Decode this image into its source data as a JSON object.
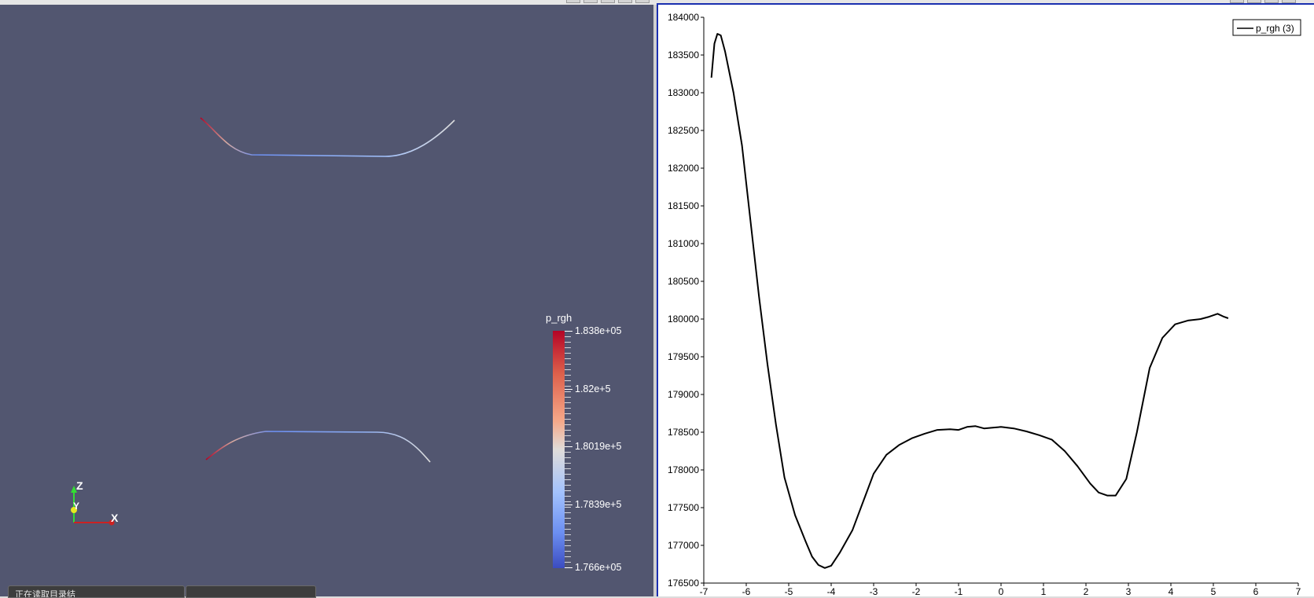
{
  "render_view": {
    "color_legend": {
      "title": "p_rgh",
      "labels": [
        "1.838e+05",
        "1.82e+5",
        "1.8019e+5",
        "1.7839e+5",
        "1.766e+05"
      ]
    },
    "orientation_axes": {
      "z": "Z",
      "y": "Y",
      "x": "X"
    }
  },
  "status_bar": {
    "tab_1": "正在读取目录结",
    "tab_2": ""
  },
  "chart_data": {
    "type": "line",
    "title": "",
    "xlabel": "",
    "ylabel": "",
    "xlim": [
      -7,
      7
    ],
    "ylim": [
      176500,
      184000
    ],
    "x_ticks": [
      "-7",
      "-6",
      "-5",
      "-4",
      "-3",
      "-2",
      "-1",
      "0",
      "1",
      "2",
      "3",
      "4",
      "5",
      "6",
      "7"
    ],
    "y_ticks": [
      "184000",
      "183500",
      "183000",
      "182500",
      "182000",
      "181500",
      "181000",
      "180500",
      "180000",
      "179500",
      "179000",
      "178500",
      "178000",
      "177500",
      "177000",
      "176500"
    ],
    "legend_position": "top-right",
    "series": [
      {
        "name": "p_rgh (3)",
        "color": "#000000",
        "points": [
          [
            -6.82,
            183200
          ],
          [
            -6.75,
            183650
          ],
          [
            -6.68,
            183780
          ],
          [
            -6.6,
            183760
          ],
          [
            -6.5,
            183550
          ],
          [
            -6.3,
            183000
          ],
          [
            -6.1,
            182300
          ],
          [
            -5.9,
            181300
          ],
          [
            -5.7,
            180300
          ],
          [
            -5.5,
            179400
          ],
          [
            -5.3,
            178600
          ],
          [
            -5.1,
            177900
          ],
          [
            -4.85,
            177400
          ],
          [
            -4.6,
            177050
          ],
          [
            -4.45,
            176850
          ],
          [
            -4.3,
            176740
          ],
          [
            -4.15,
            176700
          ],
          [
            -4.0,
            176730
          ],
          [
            -3.8,
            176900
          ],
          [
            -3.5,
            177200
          ],
          [
            -3.2,
            177650
          ],
          [
            -3.0,
            177950
          ],
          [
            -2.7,
            178200
          ],
          [
            -2.4,
            178330
          ],
          [
            -2.1,
            178420
          ],
          [
            -1.8,
            178480
          ],
          [
            -1.5,
            178530
          ],
          [
            -1.2,
            178540
          ],
          [
            -1.0,
            178530
          ],
          [
            -0.8,
            178570
          ],
          [
            -0.6,
            178580
          ],
          [
            -0.4,
            178550
          ],
          [
            -0.2,
            178560
          ],
          [
            0.0,
            178570
          ],
          [
            0.3,
            178550
          ],
          [
            0.6,
            178510
          ],
          [
            0.9,
            178460
          ],
          [
            1.2,
            178400
          ],
          [
            1.5,
            178250
          ],
          [
            1.8,
            178050
          ],
          [
            2.1,
            177820
          ],
          [
            2.3,
            177700
          ],
          [
            2.5,
            177660
          ],
          [
            2.7,
            177660
          ],
          [
            2.95,
            177880
          ],
          [
            3.2,
            178500
          ],
          [
            3.5,
            179350
          ],
          [
            3.8,
            179750
          ],
          [
            4.1,
            179930
          ],
          [
            4.4,
            179980
          ],
          [
            4.7,
            180000
          ],
          [
            4.9,
            180030
          ],
          [
            5.1,
            180070
          ],
          [
            5.25,
            180030
          ],
          [
            5.35,
            180010
          ]
        ]
      }
    ]
  }
}
